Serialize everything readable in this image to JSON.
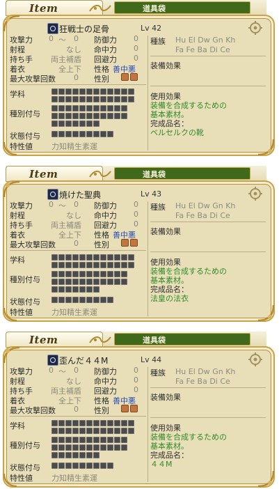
{
  "screen": {
    "title": "Item",
    "tab_label": "道具袋"
  },
  "labels": {
    "attack": "攻撃力",
    "range": "射程",
    "hold": "持ち手",
    "wear": "着衣",
    "max_attacks": "最大攻撃回数",
    "defense": "防御力",
    "accuracy": "命中力",
    "evasion": "回避力",
    "nature": "性格",
    "gender": "性別",
    "subject": "学科",
    "type_grant": "種別付与",
    "status_grant": "状態付与",
    "aptitude": "特性値",
    "race": "種族",
    "equip_effect": "装備効果",
    "use_effect": "使用効果",
    "level_prefix": "Lv"
  },
  "panels": [
    {
      "item_name": "狂戦士の足骨",
      "level": "42",
      "attack_min": "0",
      "attack_sep": "〜",
      "attack_max": "0",
      "defense": "0",
      "range": "なし",
      "accuracy": "0",
      "hold": "両主補盾",
      "evasion": "0",
      "wear": "全上下",
      "nature_values": "善中悪",
      "max_attacks": "0",
      "race_line1": "Hu El Dw Gn Kh",
      "race_line2": "Fa Fe Ba Di Ce",
      "aptitude_values": "力知精生素運",
      "use_effect_line1": "装備を合成するための",
      "use_effect_line2": "基本素材。",
      "product_label": "完成品名：",
      "product_name": "ベルセルクの靴"
    },
    {
      "item_name": "焼けた聖典",
      "level": "43",
      "attack_min": "0",
      "attack_sep": "〜",
      "attack_max": "0",
      "defense": "0",
      "range": "なし",
      "accuracy": "0",
      "hold": "両主補盾",
      "evasion": "0",
      "wear": "全上下",
      "nature_values": "善中悪",
      "max_attacks": "0",
      "race_line1": "Hu El Dw Gn Kh",
      "race_line2": "Fa Fe Ba Di Ce",
      "aptitude_values": "力知精生素運",
      "use_effect_line1": "装備を合成するための",
      "use_effect_line2": "基本素材。",
      "product_label": "完成品名：",
      "product_name": "法皇の法衣"
    },
    {
      "item_name": "歪んだ４４M",
      "level": "44",
      "attack_min": "0",
      "attack_sep": "〜",
      "attack_max": "0",
      "defense": "0",
      "range": "なし",
      "accuracy": "0",
      "hold": "両主補盾",
      "evasion": "0",
      "wear": "全上下",
      "nature_values": "善中悪",
      "max_attacks": "0",
      "race_line1": "Hu El Dw Gn Kh",
      "race_line2": "Fa Fe Ba Di Ce",
      "aptitude_values": "力知精生素運",
      "use_effect_line1": "装備を合成するための",
      "use_effect_line2": "基本素材。",
      "product_label": "完成品名：",
      "product_name": "４４M"
    }
  ],
  "colors": {
    "frame": "#c9a24a",
    "panel_bg": "#e8dfb8",
    "label_red": "#e04a3a",
    "effect_green": "#2f8a2a",
    "tab_green": "#3f6a1c",
    "nature_blue": "#2448b8"
  }
}
